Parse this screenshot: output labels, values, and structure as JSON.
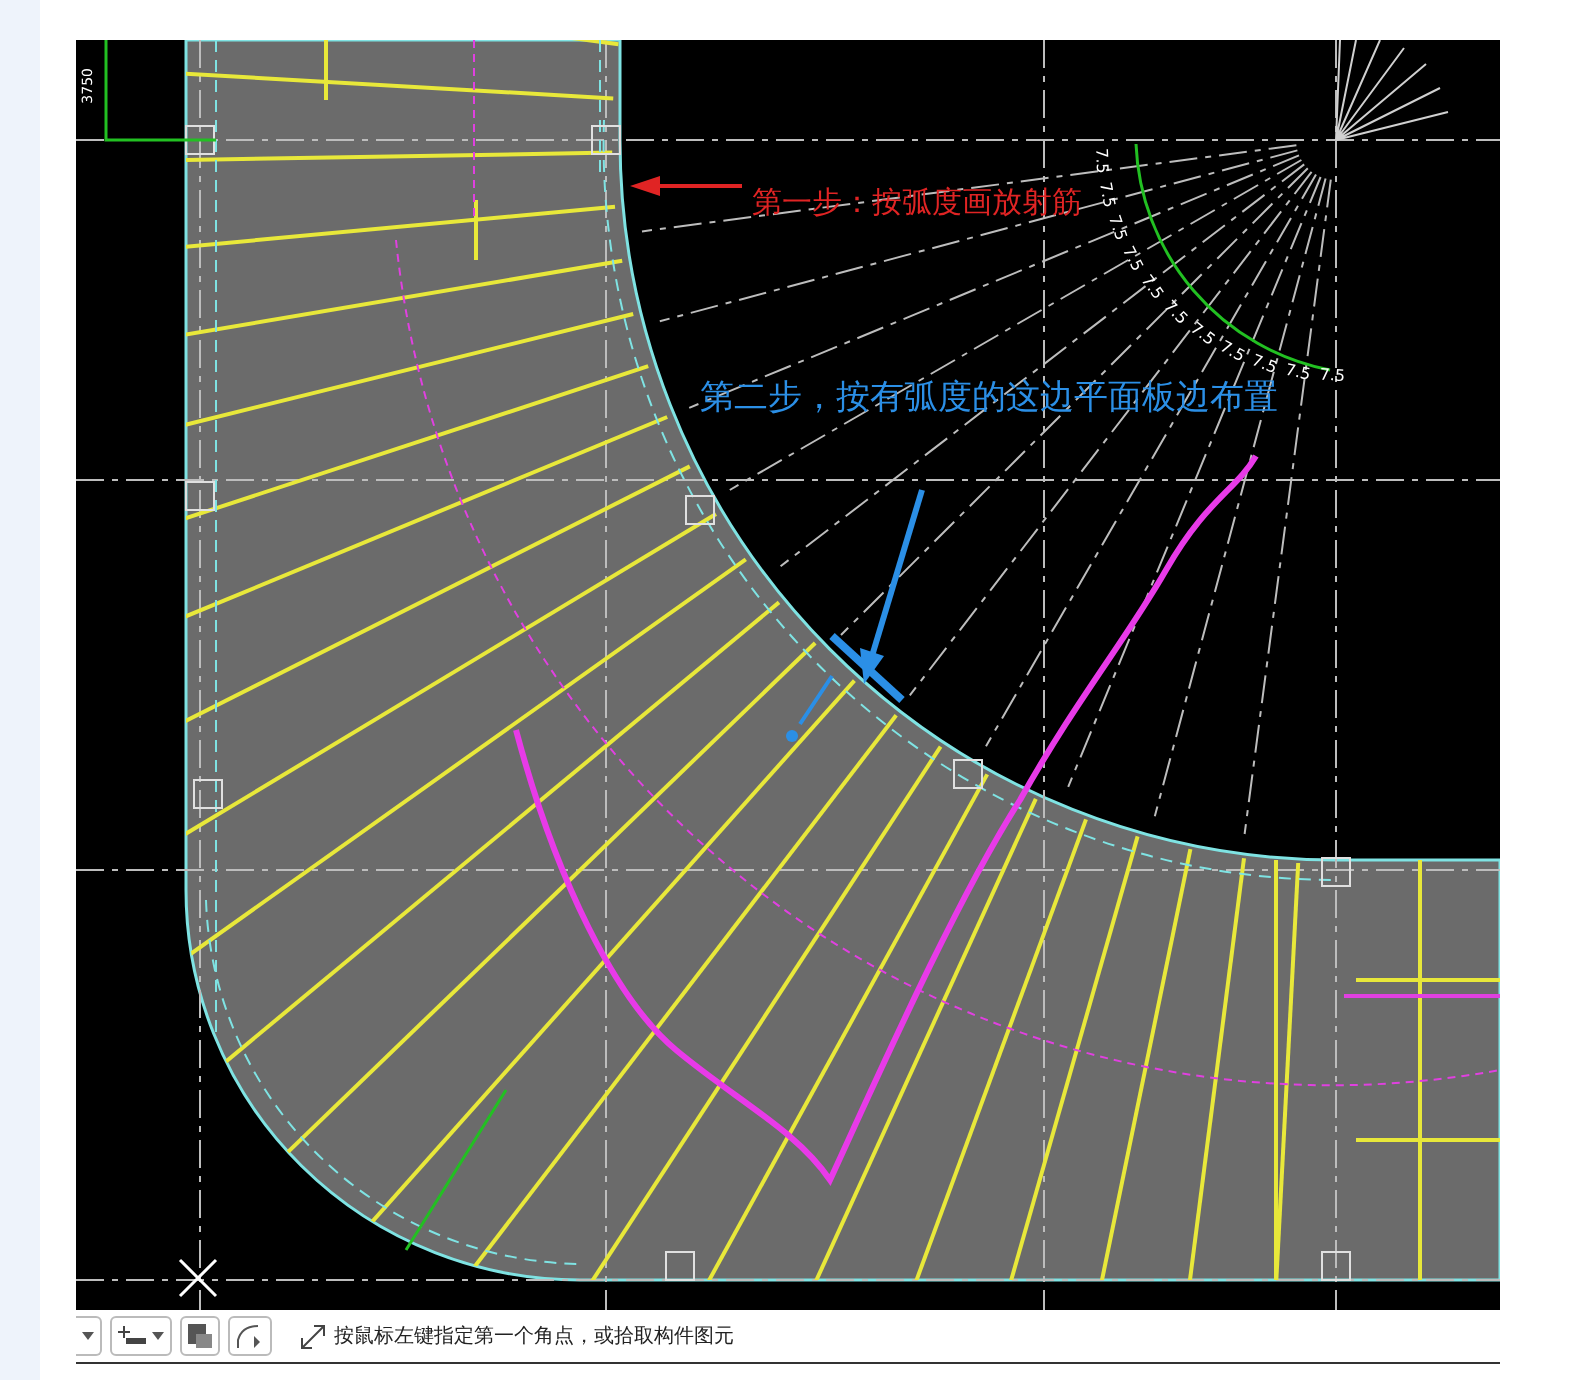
{
  "drawing": {
    "dimension_label": "3750",
    "angle_labels": [
      "7.5",
      "7.5",
      "7.5",
      "7.5",
      "7.5",
      "7.5",
      "7.5",
      "7.5",
      "7.5",
      "7.5",
      "7.5"
    ],
    "annotations": [
      {
        "text": "第一步：按弧度画放射筋",
        "color": "#e02424"
      },
      {
        "text": "第二步，按有弧度的这边平面板边布置",
        "color": "#2b8fe6"
      }
    ]
  },
  "status_bar": {
    "prompt": "按鼠标左键指定第一个角点，或拾取构件图元"
  }
}
